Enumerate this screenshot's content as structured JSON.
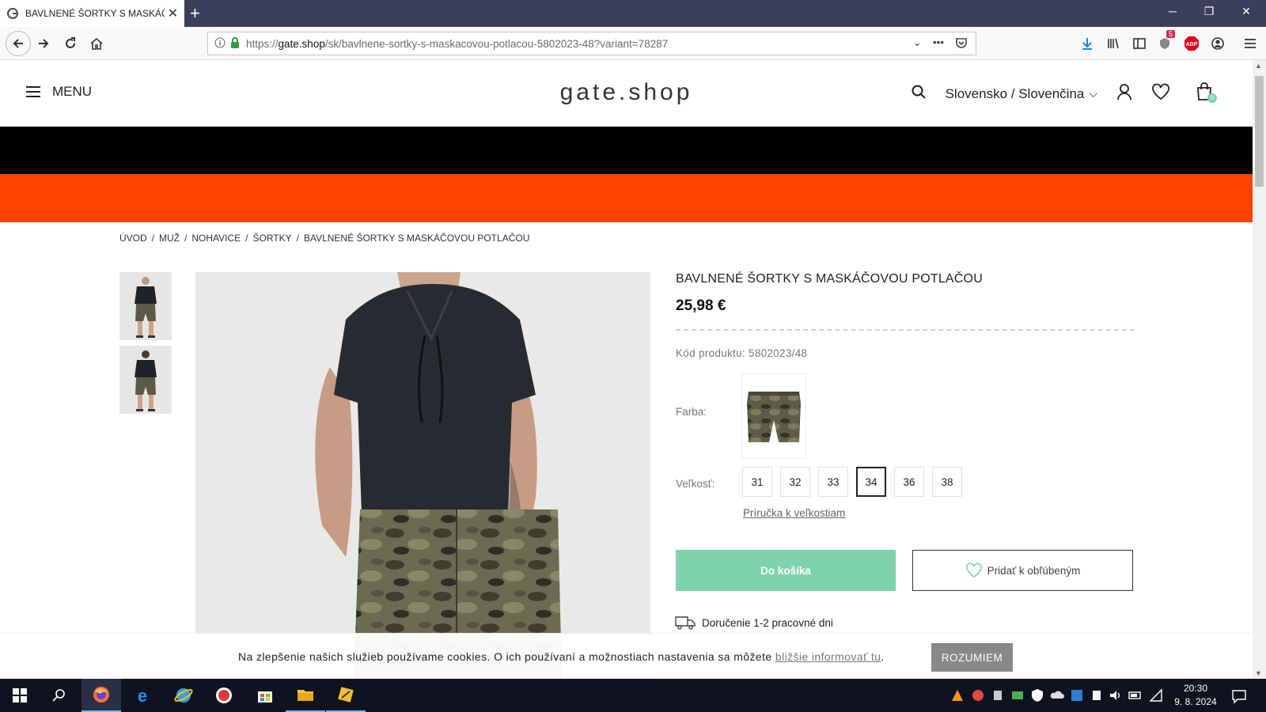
{
  "browser": {
    "tab_title": "BAVLNENÉ ŠORTKY S MASKÁČ",
    "url_prefix": "https://",
    "url_host": "gate.shop",
    "url_path": "/sk/bavlnene-sortky-s-maskacovou-potlacou-5802023-48?variant=78287",
    "badge_count": "5"
  },
  "header": {
    "menu_label": "MENU",
    "logo": "gate.shop",
    "locale": "Slovensko / Slovenčina",
    "cart_count": "0"
  },
  "breadcrumb": [
    "ÚVOD",
    "MUŽ",
    "NOHAVICE",
    "ŠORTKY",
    "BAVLNENÉ ŠORTKY S MASKÁČOVOU POTLAČOU"
  ],
  "product": {
    "title": "BAVLNENÉ ŠORTKY S MASKÁČOVOU POTLAČOU",
    "price": "25,98 €",
    "code": "Kód produktu: 5802023/48",
    "color_label": "Farba:",
    "size_label": "Veľkosť:",
    "sizes": [
      "31",
      "32",
      "33",
      "34",
      "36",
      "38"
    ],
    "selected_size": "34",
    "size_guide": "Príručka k veľkostiam",
    "add_to_cart": "Do košíka",
    "add_to_favorites": "Pridať k obľúbeným",
    "delivery": "Doručenie 1-2 pracovné dni"
  },
  "cookie": {
    "text": "Na zlepšenie našich služieb používame cookies. O ich používaní a možnostiach nastavenia sa môžete ",
    "link": "bližšie informovať tu",
    "tail": ".",
    "button": "ROZUMIEM"
  },
  "taskbar": {
    "time": "20:30",
    "date": "9. 8. 2024"
  },
  "colors": {
    "accent_orange": "#ff4200",
    "cart_green": "#7ed3ac",
    "badge_green": "#7ed3ac",
    "badge_red": "#e22850"
  }
}
